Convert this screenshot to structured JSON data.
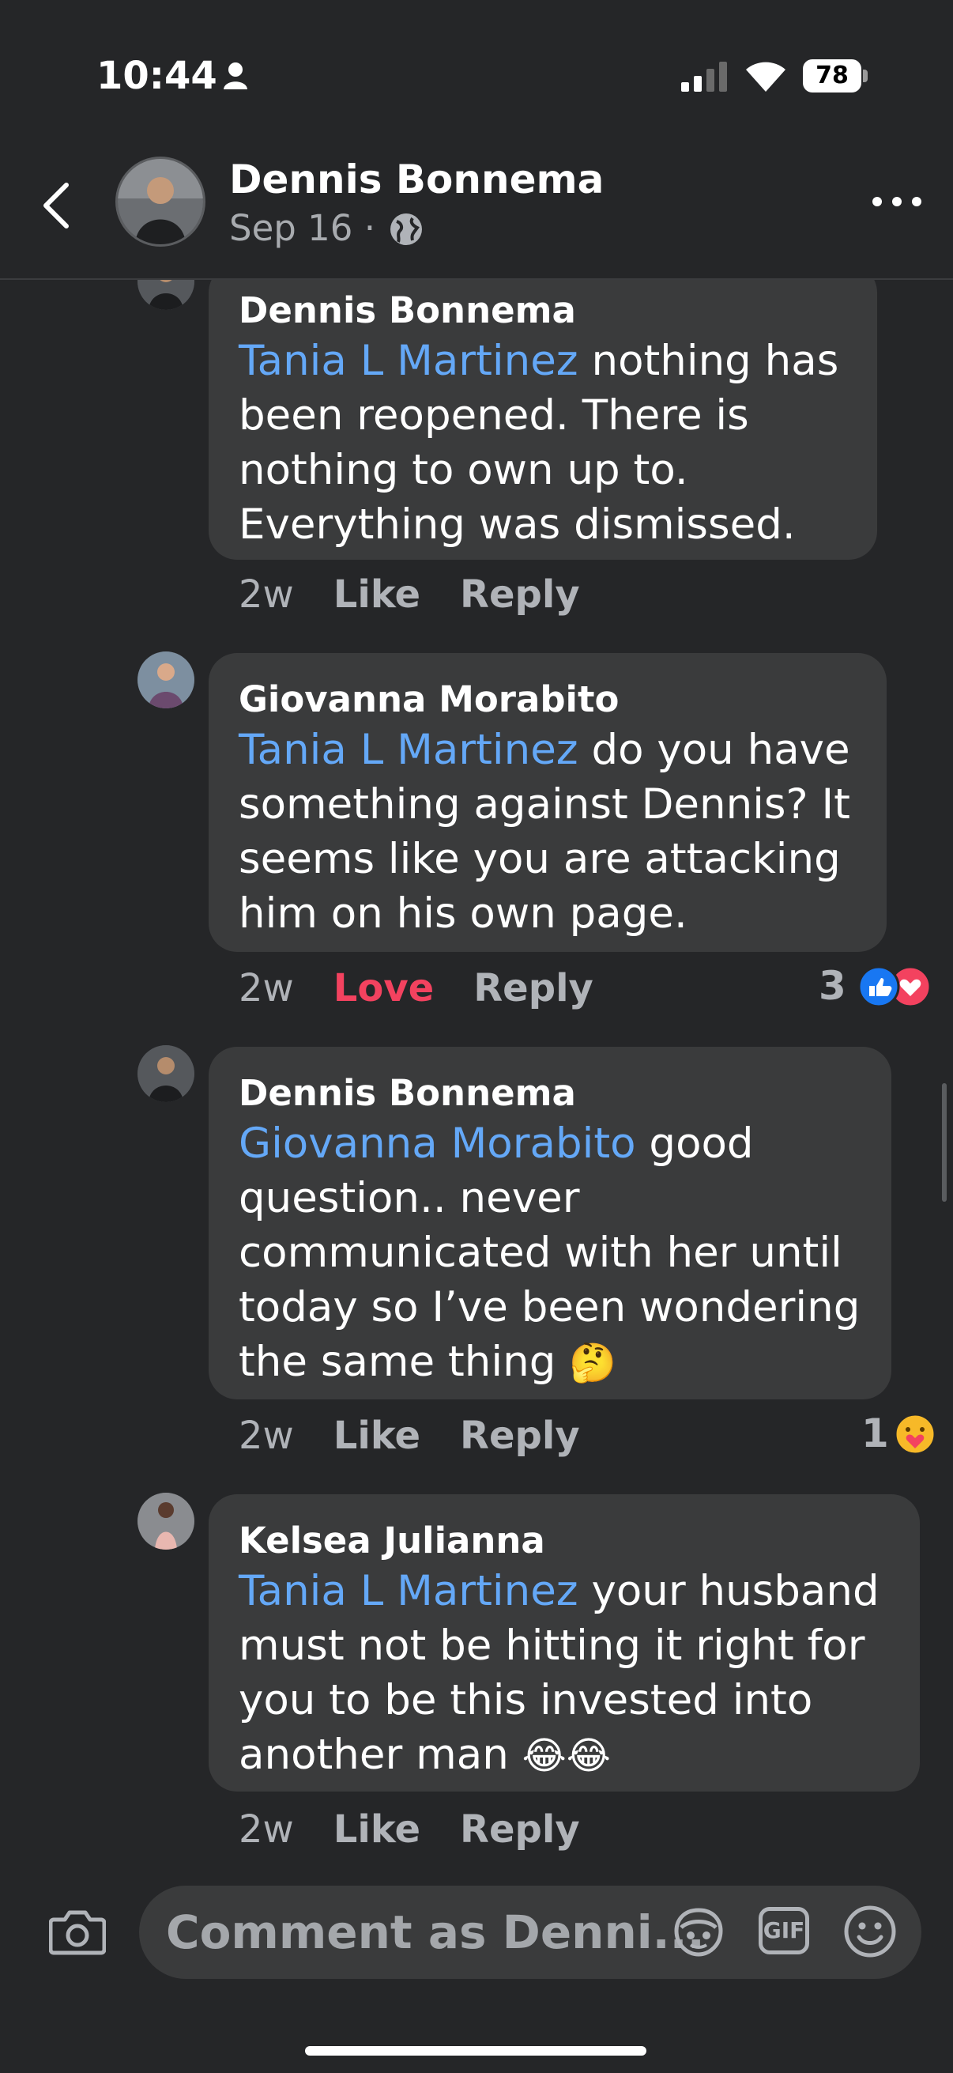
{
  "status": {
    "time": "10:44",
    "battery": "78"
  },
  "header": {
    "name": "Dennis Bonnema",
    "date": "Sep 16",
    "separator": "·"
  },
  "comments": [
    {
      "author": "Dennis Bonnema",
      "mention": "Tania L Martinez",
      "text": " nothing has been reopened. There is nothing to own up to. Everything was dismissed.",
      "time_ago": "2w",
      "like_label": "Like",
      "reply_label": "Reply"
    },
    {
      "author": "Giovanna Morabito",
      "mention": "Tania L Martinez",
      "text": " do you have something against Dennis? It seems like you are attacking him on his own page.",
      "time_ago": "2w",
      "like_label": "Love",
      "reply_label": "Reply",
      "reaction_count": "3"
    },
    {
      "author": "Dennis Bonnema",
      "mention": "Giovanna Morabito",
      "text": " good question.. never communicated with her until today so I’ve been wondering the same thing ",
      "emoji": "🤔",
      "time_ago": "2w",
      "like_label": "Like",
      "reply_label": "Reply",
      "reaction_count": "1"
    },
    {
      "author": "Kelsea Julianna",
      "mention": "Tania L Martinez",
      "text": " your husband must not be hitting it right for you to be this invested into another man ",
      "emoji": "😂😂",
      "time_ago": "2w",
      "like_label": "Like",
      "reply_label": "Reply"
    }
  ],
  "composer": {
    "placeholder": "Comment as Denni...",
    "gif_label": "GIF"
  },
  "colors": {
    "background": "#252628",
    "bubble": "#3a3b3c",
    "mention": "#64a8f7",
    "love": "#f3425f",
    "like_blue": "#1877f2"
  }
}
